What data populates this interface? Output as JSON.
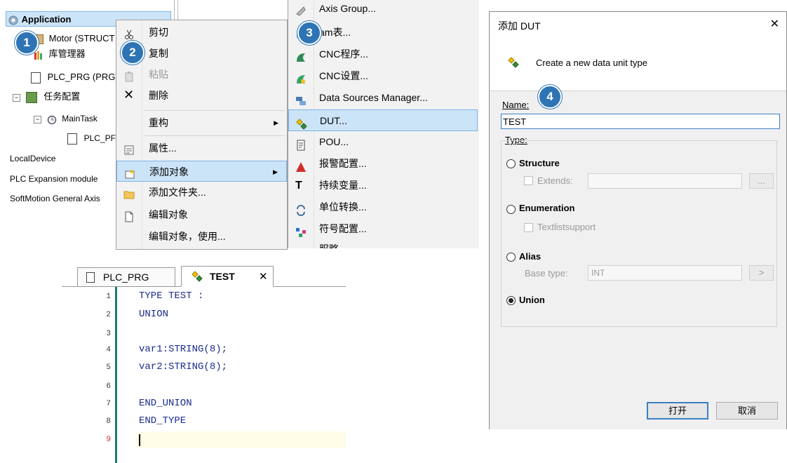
{
  "tree": {
    "application": "Application",
    "motor": "Motor (STRUCT",
    "library_manager": "库管理器",
    "plc_prg": "PLC_PRG (PRG)",
    "task_config": "任务配置",
    "main_task": "MainTask",
    "plc_prg_child": "PLC_PF",
    "local_device": "LocalDevice",
    "plc_expansion": "PLC Expansion module",
    "softmotion": "SoftMotion General Axis"
  },
  "context_menu": {
    "items": [
      {
        "label": "剪切",
        "icon": "scissors-icon"
      },
      {
        "label": "复制",
        "icon": "copy-icon"
      },
      {
        "label": "粘贴",
        "icon": "paste-icon",
        "disabled": true
      },
      {
        "label": "删除",
        "icon": "delete-x-icon"
      },
      {
        "label": "重构",
        "icon": "",
        "submenu": true
      },
      {
        "label": "属性...",
        "icon": "properties-icon"
      },
      {
        "label": "添加对象",
        "icon": "add-object-icon",
        "submenu": true,
        "highlighted": true
      },
      {
        "label": "添加文件夹...",
        "icon": "folder-icon"
      },
      {
        "label": "编辑对象",
        "icon": "edit-icon"
      },
      {
        "label": "编辑对象，使用...",
        "icon": ""
      }
    ]
  },
  "submenu": {
    "items": [
      {
        "label": "Axis Group...",
        "icon": "axis-group-icon"
      },
      {
        "label": "am表...",
        "icon": "cam-table-icon"
      },
      {
        "label": "CNC程序...",
        "icon": "cnc-program-icon"
      },
      {
        "label": "CNC设置...",
        "icon": "cnc-settings-icon"
      },
      {
        "label": "Data Sources Manager...",
        "icon": "data-sources-icon"
      },
      {
        "label": "DUT...",
        "icon": "dut-icon",
        "highlighted": true
      },
      {
        "label": "POU...",
        "icon": "pou-icon"
      },
      {
        "label": "报警配置...",
        "icon": "alarm-icon"
      },
      {
        "label": "持续变量...",
        "icon": "persistent-vars-icon"
      },
      {
        "label": "单位转换...",
        "icon": "unit-conversion-icon"
      },
      {
        "label": "符号配置...",
        "icon": "symbol-config-icon"
      },
      {
        "label": "服略",
        "icon": "partial-icon"
      }
    ]
  },
  "badges": [
    "1",
    "2",
    "3",
    "4"
  ],
  "editor": {
    "tabs": [
      {
        "label": "PLC_PRG"
      },
      {
        "label": "TEST",
        "active": true
      }
    ],
    "lines": [
      {
        "num": "1",
        "code": "TYPE TEST :"
      },
      {
        "num": "2",
        "code": "UNION"
      },
      {
        "num": "3",
        "code": ""
      },
      {
        "num": "4",
        "code": "var1:STRING(8);"
      },
      {
        "num": "5",
        "code": "var2:STRING(8);"
      },
      {
        "num": "6",
        "code": ""
      },
      {
        "num": "7",
        "code": "END_UNION"
      },
      {
        "num": "8",
        "code": "END_TYPE"
      },
      {
        "num": "9",
        "code": ""
      }
    ]
  },
  "dialog": {
    "title": "添加 DUT",
    "close": "✕",
    "header_text": "Create a new data unit type",
    "name_label": "Name:",
    "name_value": "TEST",
    "type_label": "Type:",
    "structure": "Structure",
    "extends": "Extends:",
    "browse": "...",
    "enumeration": "Enumeration",
    "textlistsupport": "Textlistsupport",
    "alias": "Alias",
    "base_type": "Base type:",
    "base_type_value": "INT",
    "base_type_btn": ">",
    "union": "Union",
    "selected_type": "Union",
    "ok": "打开",
    "cancel": "取消"
  },
  "colors": {
    "highlight": "#cce4f7",
    "highlight_border": "#7eb4ea",
    "badge": "#2e74b5",
    "code": "#1a2c8c",
    "editor_line": "#fdfde8"
  }
}
